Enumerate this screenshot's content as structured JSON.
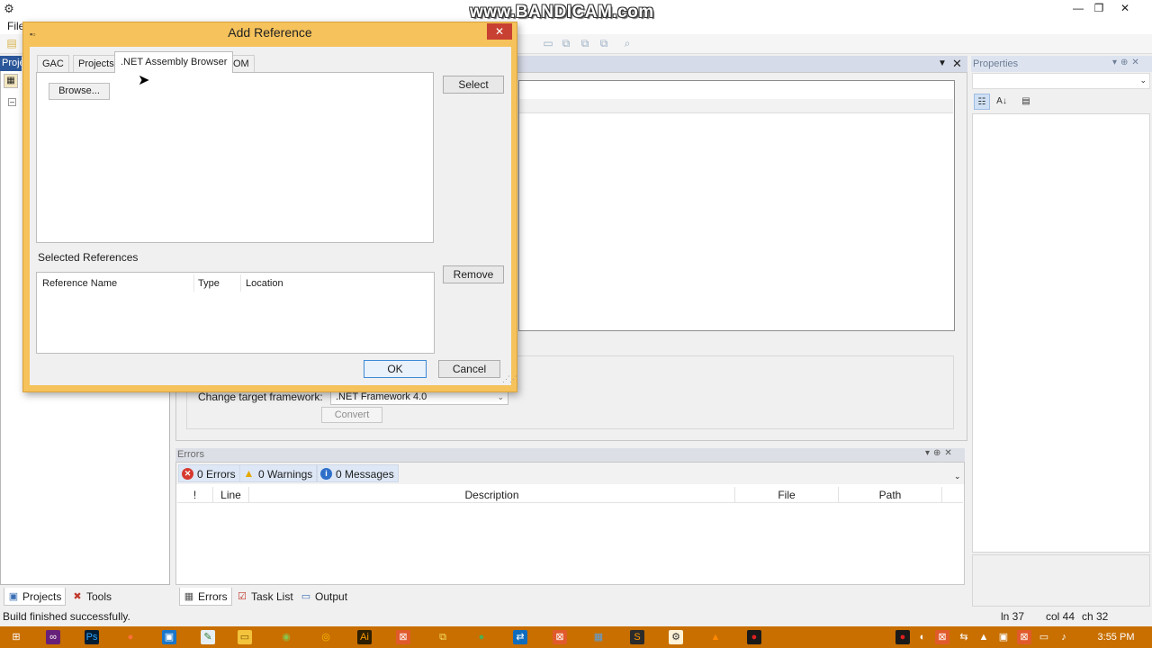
{
  "watermark": "www.BANDICAM.com",
  "menu": {
    "file": "File"
  },
  "window_controls": {
    "minimize": "—",
    "restore": "❐",
    "close": "✕"
  },
  "left_panel": {
    "header": "Proje",
    "tabs": {
      "projects": "Projects",
      "tools": "Tools"
    }
  },
  "document": {
    "target_label": "Change target framework:",
    "framework_value": ".NET Framework 4.0",
    "convert_label": "Convert"
  },
  "errors_panel": {
    "title": "Errors",
    "filters": {
      "errors": "0 Errors",
      "warnings": "0 Warnings",
      "messages": "0 Messages"
    },
    "columns": [
      "!",
      "Line",
      "Description",
      "File",
      "Path"
    ],
    "tabs": {
      "errors": "Errors",
      "task_list": "Task List",
      "output": "Output"
    }
  },
  "properties": {
    "title": "Properties"
  },
  "status": {
    "text": "Build finished successfully.",
    "ln": "ln 37",
    "col": "col 44",
    "ch": "ch 32"
  },
  "clock": "3:55 PM",
  "dialog": {
    "title": "Add Reference",
    "tabs": {
      "gac": "GAC",
      "projects": "Projects",
      "net_browser": ".NET Assembly Browser",
      "com": "COM"
    },
    "browse_label": "Browse...",
    "select_label": "Select",
    "selected_refs_label": "Selected References",
    "ref_columns": {
      "name": "Reference Name",
      "type": "Type",
      "location": "Location"
    },
    "remove_label": "Remove",
    "ok_label": "OK",
    "cancel_label": "Cancel"
  },
  "colors": {
    "dialog_frame": "#f5c25b",
    "taskbar": "#c86f00",
    "accent": "#2b579a",
    "close_red": "#c84031"
  },
  "icons": {
    "app": "app-icon",
    "error": "error-icon",
    "warning": "warning-icon",
    "info": "info-icon"
  }
}
